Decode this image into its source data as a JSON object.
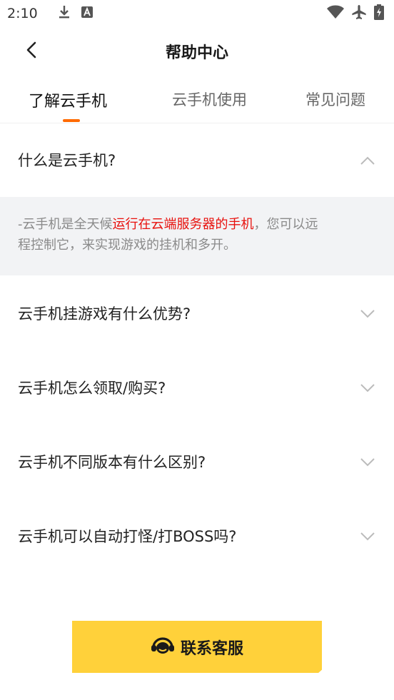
{
  "status_bar": {
    "time": "2:10"
  },
  "header": {
    "title": "帮助中心"
  },
  "tabs": [
    {
      "label": "了解云手机",
      "active": true
    },
    {
      "label": "云手机使用",
      "active": false
    },
    {
      "label": "常见问题",
      "active": false
    }
  ],
  "faq": [
    {
      "question": "什么是云手机?",
      "expanded": true,
      "answer": {
        "prefix": "-云手机是全天候",
        "highlight": "运行在云端服务器的手机",
        "line1_rest": "，您可以远",
        "line2": "程控制它，来实现游戏的挂机和多开。"
      }
    },
    {
      "question": "云手机挂游戏有什么优势?",
      "expanded": false
    },
    {
      "question": "云手机怎么领取/购买?",
      "expanded": false
    },
    {
      "question": "云手机不同版本有什么区别?",
      "expanded": false
    },
    {
      "question": "云手机可以自动打怪/打BOSS吗?",
      "expanded": false
    }
  ],
  "contact_button": {
    "label": "联系客服"
  },
  "colors": {
    "accent_orange": "#ff6a00",
    "highlight_red": "#e8110d",
    "button_yellow": "#ffd13a"
  }
}
